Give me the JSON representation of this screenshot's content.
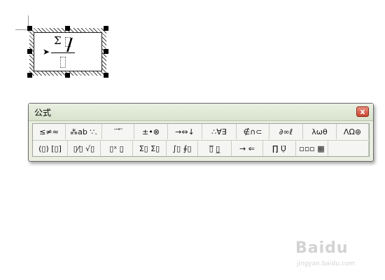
{
  "toolbar": {
    "title": "公式",
    "close_label": "x",
    "row_top": [
      {
        "name": "relational-symbols-button",
        "label": "≤≠≈"
      },
      {
        "name": "spaces-ellipses-button",
        "label": "⁂ab ∵."
      },
      {
        "name": "embellishments-button",
        "label": "¨ ⃗ ⃛"
      },
      {
        "name": "operator-symbols-button",
        "label": "±•⊗"
      },
      {
        "name": "arrow-symbols-button",
        "label": "→⇔↓"
      },
      {
        "name": "logical-symbols-button",
        "label": "∴∀∃"
      },
      {
        "name": "set-theory-symbols-button",
        "label": "∉∩⊂"
      },
      {
        "name": "misc-symbols-button",
        "label": "∂∞ℓ"
      },
      {
        "name": "greek-lowercase-button",
        "label": "λωθ"
      },
      {
        "name": "greek-uppercase-button",
        "label": "ΛΩ⊛"
      }
    ],
    "row_bottom": [
      {
        "name": "fence-templates-button",
        "label": "(▯) [▯]"
      },
      {
        "name": "fraction-radical-templates-button",
        "label": "▯⁄▯ √▯"
      },
      {
        "name": "subscript-superscript-templates-button",
        "label": "▯ˣ ▯̣"
      },
      {
        "name": "summation-templates-button",
        "label": "Σ▯ Σ▯"
      },
      {
        "name": "integral-templates-button",
        "label": "∫▯ ∮▯"
      },
      {
        "name": "underbar-overbar-templates-button",
        "label": "▯̅ ▯̲"
      },
      {
        "name": "labeled-arrow-templates-button",
        "label": "→ ⇐"
      },
      {
        "name": "products-set-theory-templates-button",
        "label": "∏̣ Ụ̈"
      },
      {
        "name": "matrix-templates-button",
        "label": "▫▫▫ ▦"
      },
      {
        "name": "empty-slot-button",
        "label": ""
      }
    ]
  },
  "equation": {
    "sigma": "Σ",
    "slash": "/",
    "arrow": "➤"
  },
  "watermark": {
    "brand": "Baidu",
    "url": "jingyan.baidu.com"
  }
}
